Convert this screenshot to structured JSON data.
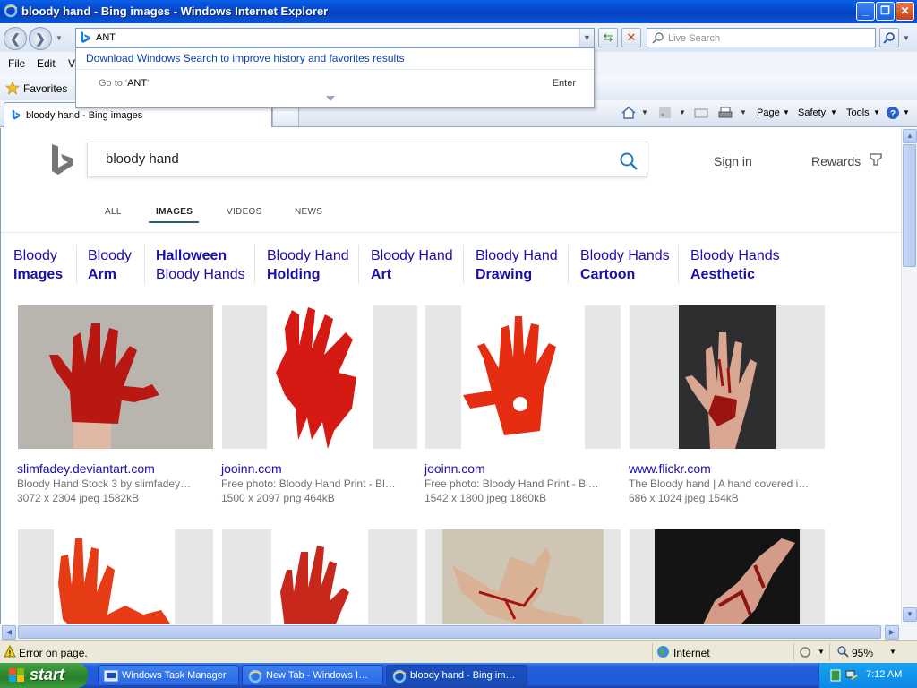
{
  "window": {
    "title": "bloody hand - Bing images - Windows Internet Explorer"
  },
  "address": {
    "value": "ANT"
  },
  "dropdown": {
    "download_text": "Download Windows Search to improve history and favorites results",
    "goto_prefix": "Go to '",
    "goto_value": "ANT",
    "goto_suffix": "'",
    "enter_label": "Enter"
  },
  "search": {
    "placeholder": "Live Search"
  },
  "menu": {
    "file": "File",
    "edit": "Edit",
    "view": "Vi"
  },
  "favorites": {
    "label": "Favorites"
  },
  "tab": {
    "label": "bloody hand - Bing images"
  },
  "commands": {
    "page": "Page",
    "safety": "Safety",
    "tools": "Tools"
  },
  "bing": {
    "query": "bloody hand",
    "sign_in": "Sign in",
    "rewards": "Rewards",
    "nav": [
      "ALL",
      "IMAGES",
      "VIDEOS",
      "NEWS"
    ],
    "related": [
      {
        "line1": "Bloody",
        "line2": "Images",
        "bold2": true
      },
      {
        "line1": "Bloody",
        "line2": "Arm",
        "bold2": true
      },
      {
        "line1": "Halloween",
        "line2": "Bloody Hands",
        "bold1": true
      },
      {
        "line1": "Bloody Hand",
        "line2": "Holding",
        "bold2": true
      },
      {
        "line1": "Bloody Hand",
        "line2": "Art",
        "bold2": true
      },
      {
        "line1": "Bloody Hand",
        "line2": "Drawing",
        "bold2": true
      },
      {
        "line1": "Bloody Hands",
        "line2": "Cartoon",
        "bold2": true
      },
      {
        "line1": "Bloody Hands",
        "line2": "Aesthetic",
        "bold2": true
      }
    ],
    "results": [
      {
        "source": "slimfadey.deviantart.com",
        "desc": "Bloody Hand Stock 3 by slimfadey…",
        "meta": "3072 x 2304 jpeg 1582kB"
      },
      {
        "source": "jooinn.com",
        "desc": "Free photo: Bloody Hand Print - Bl…",
        "meta": "1500 x 2097 png 464kB"
      },
      {
        "source": "jooinn.com",
        "desc": "Free photo: Bloody Hand Print - Bl…",
        "meta": "1542 x 1800 jpeg 1860kB"
      },
      {
        "source": "www.flickr.com",
        "desc": "The Bloody hand | A hand covered i…",
        "meta": "686 x 1024 jpeg 154kB"
      }
    ]
  },
  "status": {
    "message": "Error on page.",
    "zone": "Internet",
    "zoom": "95%"
  },
  "taskbar": {
    "start": "start",
    "items": [
      "Windows Task Manager",
      "New Tab - Windows I…",
      "bloody hand - Bing im…"
    ],
    "clock": "7:12 AM"
  },
  "colors": {
    "title_blue": "#0546c9",
    "link_blue": "#1a0dab",
    "blood_red": "#d41a12",
    "taskbar_blue": "#245edb",
    "start_green": "#2f8a2f"
  }
}
